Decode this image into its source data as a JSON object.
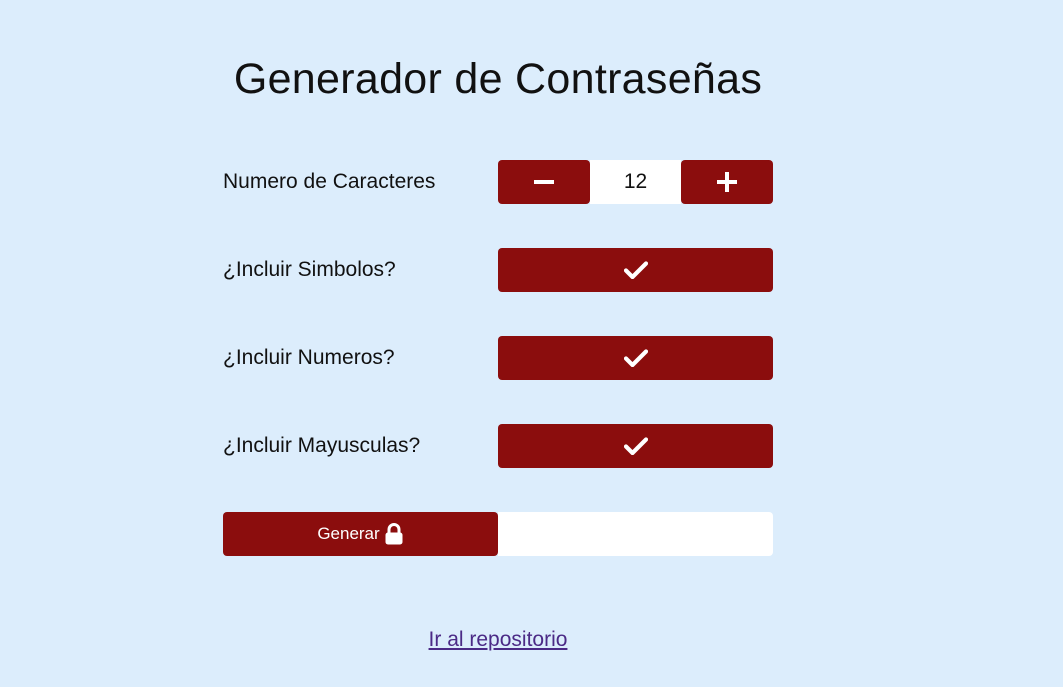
{
  "page": {
    "title": "Generador de Contraseñas"
  },
  "options": {
    "length": {
      "label": "Numero de Caracteres",
      "value": "12",
      "decrement_icon": "minus-icon",
      "increment_icon": "plus-icon"
    },
    "symbols": {
      "label": "¿Incluir Simbolos?",
      "checked": true,
      "icon": "check-icon"
    },
    "numbers": {
      "label": "¿Incluir Numeros?",
      "checked": true,
      "icon": "check-icon"
    },
    "uppercase": {
      "label": "¿Incluir Mayusculas?",
      "checked": true,
      "icon": "check-icon"
    }
  },
  "generate": {
    "label": "Generar",
    "icon": "lock-icon",
    "output_value": ""
  },
  "footer": {
    "repo_link_label": "Ir al repositorio"
  },
  "colors": {
    "background": "#dcedfc",
    "accent": "#8b0d0d",
    "link": "#4b2a86"
  }
}
